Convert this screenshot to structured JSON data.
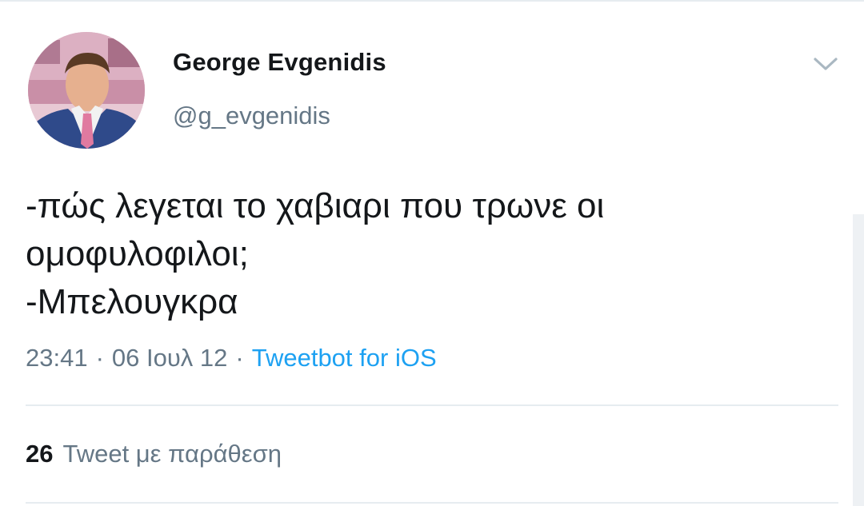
{
  "author": {
    "display_name": "George Evgenidis",
    "handle": "@g_evgenidis",
    "avatar_icon": "profile-photo"
  },
  "menu": {
    "icon": "chevron-down-icon"
  },
  "tweet": {
    "lines": [
      "-πώς λεγεται το χαβιαρι που τρωνε οι",
      "ομοφυλοφιλοι;",
      "-Μπελουγκρα"
    ]
  },
  "meta": {
    "time": "23:41",
    "date": "06 Ιουλ 12",
    "separator": "·",
    "source": "Tweetbot for iOS"
  },
  "stats": {
    "quote_count": "26",
    "quote_label": "Tweet με παράθεση"
  },
  "colors": {
    "text": "#14171a",
    "secondary": "#657786",
    "link": "#1da1f2",
    "divider": "#e6ecf0"
  }
}
